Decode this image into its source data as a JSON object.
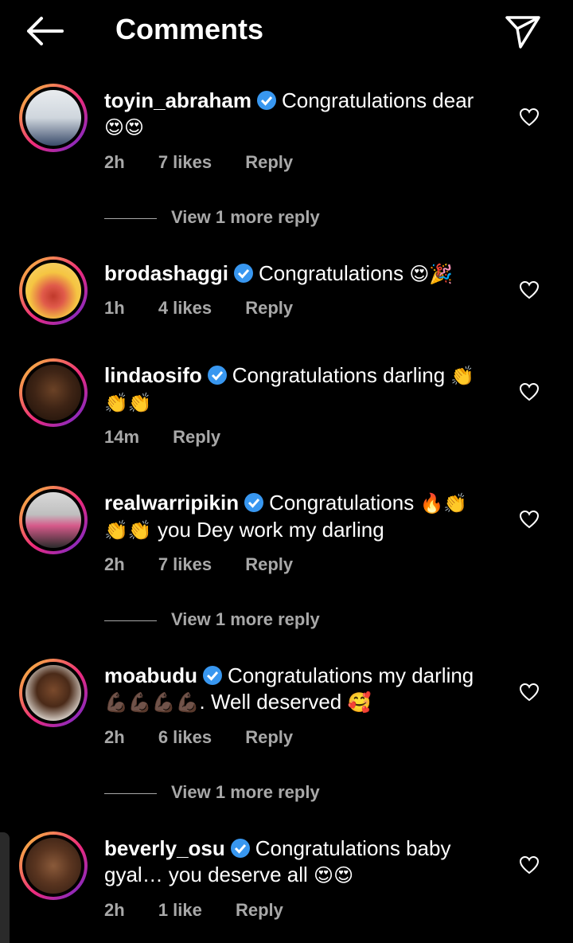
{
  "header": {
    "title": "Comments",
    "back_icon": "arrow-left-icon",
    "share_icon": "paper-plane-icon"
  },
  "comments": [
    {
      "username": "toyin_abraham",
      "text": "Congratulations dear",
      "emoji": "😍😍",
      "time": "2h",
      "likes": "7 likes",
      "reply": "Reply",
      "view_more": "View 1 more reply"
    },
    {
      "username": "brodashaggi",
      "text": "Congratulations",
      "emoji": "😍🎉",
      "time": "1h",
      "likes": "4 likes",
      "reply": "Reply"
    },
    {
      "username": "lindaosifo",
      "text": "Congratulations darling",
      "emoji": "👏👏👏",
      "time": "14m",
      "reply": "Reply"
    },
    {
      "username": "realwarripikin",
      "text": "Congratulations",
      "emoji_a": "🔥👏",
      "emoji_b": "👏👏",
      "text2": "you Dey work my darling",
      "time": "2h",
      "likes": "7 likes",
      "reply": "Reply",
      "view_more": "View 1 more reply"
    },
    {
      "username": "moabudu",
      "text": "Congratulations my darling",
      "emoji_a": "💪🏿💪🏿💪🏿💪🏿",
      "text2": ". Well deserved",
      "emoji_b": "🥰",
      "time": "2h",
      "likes": "6 likes",
      "reply": "Reply",
      "view_more": "View 1 more reply"
    },
    {
      "username": "beverly_osu",
      "text": "Congratulations baby gyal… you deserve all",
      "emoji": "😍😍",
      "time": "2h",
      "likes": "1 like",
      "reply": "Reply"
    }
  ],
  "colors": {
    "background": "#000000",
    "text": "#ffffff",
    "secondary": "#a8a8a8",
    "verified": "#3897f0"
  }
}
